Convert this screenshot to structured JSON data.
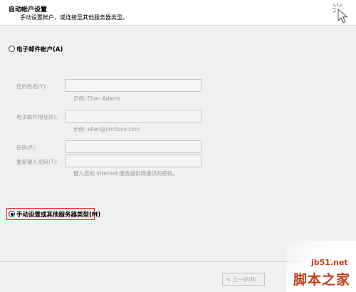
{
  "header": {
    "title": "自动帐户设置",
    "subtitle": "手动设置帐户，或连接至其他服务器类型。",
    "icon": "wizard-cursor-icon"
  },
  "options": {
    "email_account": {
      "label": "电子邮件帐户(A)",
      "selected": false
    },
    "manual_setup": {
      "label": "手动设置或其他服务器类型(M)",
      "selected": true,
      "highlight_color": "#e1251b"
    }
  },
  "form": {
    "name_label": "您的姓名(Y):",
    "name_value": "",
    "name_hint": "示例: Ellen Adams",
    "email_label": "电子邮件地址(E):",
    "email_value": "",
    "email_hint": "示例: ellen@contoso.com",
    "password_label": "密码(P):",
    "password_value": "",
    "retype_label": "重新键入密码(T):",
    "retype_value": "",
    "password_hint": "键入您的 Internet 服务提供商提供的密码。"
  },
  "footer": {
    "back_label": "< 上一步(B)"
  },
  "watermark": {
    "url": "jb51.net",
    "text": "脚本之家"
  }
}
